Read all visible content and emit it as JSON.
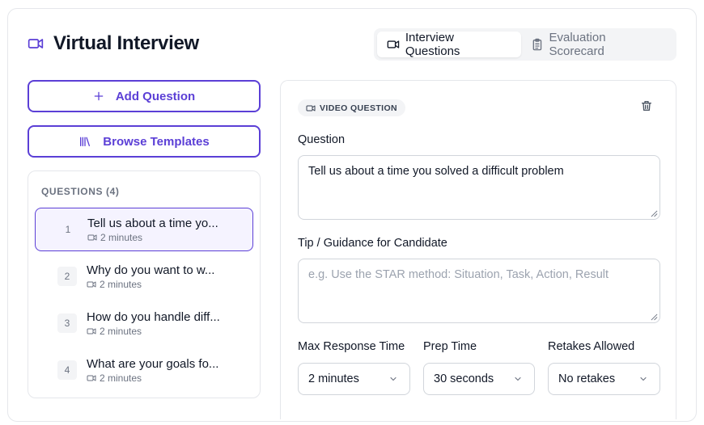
{
  "app": {
    "title": "Virtual Interview"
  },
  "tabs": [
    {
      "label": "Interview Questions",
      "active": true
    },
    {
      "label": "Evaluation Scorecard",
      "active": false
    }
  ],
  "actions": {
    "add_label": "Add Question",
    "browse_label": "Browse Templates"
  },
  "questions": {
    "header": "QUESTIONS (4)",
    "items": [
      {
        "num": "1",
        "title": "Tell us about a time yo...",
        "duration": "2 minutes",
        "active": true
      },
      {
        "num": "2",
        "title": "Why do you want to w...",
        "duration": "2 minutes",
        "active": false
      },
      {
        "num": "3",
        "title": "How do you handle diff...",
        "duration": "2 minutes",
        "active": false
      },
      {
        "num": "4",
        "title": "What are your goals fo...",
        "duration": "2 minutes",
        "active": false
      }
    ]
  },
  "editor": {
    "badge": "VIDEO QUESTION",
    "question_label": "Question",
    "question_value": "Tell us about a time you solved a difficult problem",
    "tip_label": "Tip / Guidance for Candidate",
    "tip_placeholder": "e.g. Use the STAR method: Situation, Task, Action, Result",
    "max_response_label": "Max Response Time",
    "max_response_value": "2 minutes",
    "prep_label": "Prep Time",
    "prep_value": "30 seconds",
    "retakes_label": "Retakes Allowed",
    "retakes_value": "No retakes"
  },
  "colors": {
    "accent": "#5b3fd6",
    "muted": "#6b7280",
    "border": "#e5e7eb"
  }
}
